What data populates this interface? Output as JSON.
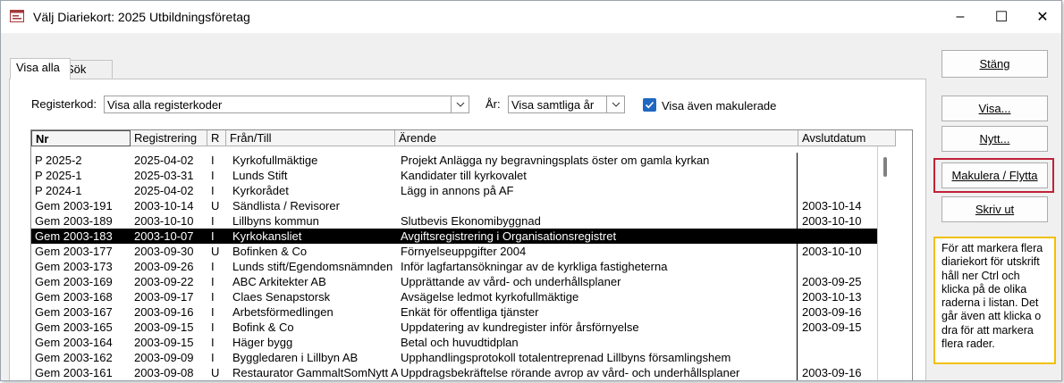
{
  "window": {
    "title": "Välj Diariekort: 2025 Utbildningsföretag",
    "controls": {
      "minimize": "–",
      "maximize": "☐",
      "close": "✕"
    }
  },
  "tabs": [
    {
      "label": "Visa alla",
      "active": true
    },
    {
      "label": "Sök",
      "active": false
    }
  ],
  "filters": {
    "registerkod_label": "Registerkod:",
    "registerkod_value": "Visa alla registerkoder",
    "ar_label": "År:",
    "ar_value": "Visa samtliga år",
    "makulerade_label": "Visa även makulerade",
    "makulerade_checked": true
  },
  "table": {
    "columns": [
      "Nr",
      "Registrering",
      "R",
      "Från/Till",
      "Ärende",
      "Avslutdatum"
    ],
    "selected_index": 5,
    "rows": [
      [
        "P 2025-2",
        "2025-04-02",
        "I",
        "Kyrkofullmäktige",
        "Projekt Anlägga ny begravningsplats öster om gamla kyrkan",
        ""
      ],
      [
        "P 2025-1",
        "2025-03-31",
        "I",
        "Lunds Stift",
        "Kandidater till kyrkovalet",
        ""
      ],
      [
        "P 2024-1",
        "2025-04-02",
        "I",
        "Kyrkorådet",
        "Lägg in annons på AF",
        ""
      ],
      [
        "Gem 2003-191",
        "2003-10-14",
        "U",
        "Sändlista / Revisorer",
        "",
        "2003-10-14"
      ],
      [
        "Gem 2003-189",
        "2003-10-10",
        "I",
        "Lillbyns kommun",
        "Slutbevis Ekonomibyggnad",
        "2003-10-10"
      ],
      [
        "Gem 2003-183",
        "2003-10-07",
        "I",
        "Kyrkokansliet",
        "Avgiftsregistrering i Organisationsregistret",
        ""
      ],
      [
        "Gem 2003-177",
        "2003-09-30",
        "U",
        "Bofinken & Co",
        "Förnyelseuppgifter 2004",
        "2003-10-10"
      ],
      [
        "Gem 2003-173",
        "2003-09-26",
        "I",
        "Lunds stift/Egendomsnämnden",
        "Inför lagfartansökningar av de kyrkliga fastigheterna",
        ""
      ],
      [
        "Gem 2003-169",
        "2003-09-22",
        "I",
        "ABC Arkitekter AB",
        "Upprättande av vård- och underhållsplaner",
        "2003-09-25"
      ],
      [
        "Gem 2003-168",
        "2003-09-17",
        "I",
        "Claes Senapstorsk",
        "Avsägelse ledmot kyrkofullmäktige",
        "2003-10-13"
      ],
      [
        "Gem 2003-167",
        "2003-09-16",
        "I",
        "Arbetsförmedlingen",
        "Enkät för offentliga tjänster",
        "2003-09-16"
      ],
      [
        "Gem 2003-165",
        "2003-09-15",
        "I",
        "Bofink & Co",
        "Uppdatering av kundregister inför årsförnyelse",
        "2003-09-15"
      ],
      [
        "Gem 2003-164",
        "2003-09-15",
        "I",
        "Häger bygg",
        "Betal och huvudtidplan",
        ""
      ],
      [
        "Gem 2003-162",
        "2003-09-09",
        "I",
        "Byggledaren i Lillbyn AB",
        "Upphandlingsprotokoll totalentreprenad Lillbyns församlingshem",
        ""
      ],
      [
        "Gem 2003-161",
        "2003-09-08",
        "U",
        "Restaurator GammaltSomNytt A",
        "Uppdragsbekräftelse rörande avrop av vård- och underhållsplaner",
        "2003-09-16"
      ]
    ]
  },
  "buttons": {
    "stang": "Stäng",
    "visa": "Visa...",
    "nytt": "Nytt...",
    "makulera": "Makulera / Flytta",
    "skriv_ut": "Skriv ut"
  },
  "help_note": "För att markera flera diariekort för utskrift håll ner Ctrl och klicka på de olika raderna i listan. Det går även att klicka o dra för att markera flera rader.",
  "colors": {
    "selection": "#000000",
    "checkbox": "#1e68c0",
    "highlight_border": "#c0223a",
    "note_border": "#f0c000"
  }
}
